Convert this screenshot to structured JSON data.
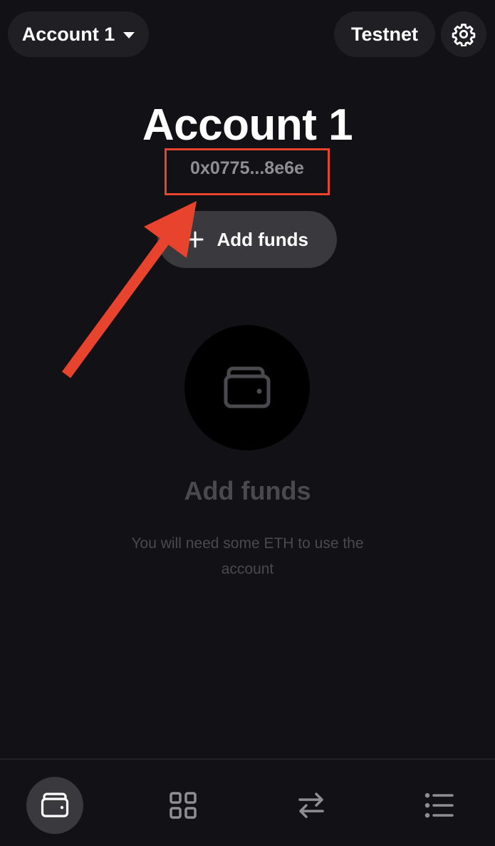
{
  "header": {
    "account_selector_label": "Account 1",
    "network_label": "Testnet"
  },
  "account": {
    "name": "Account 1",
    "address_short": "0x0775...8e6e"
  },
  "actions": {
    "add_funds_label": "Add funds"
  },
  "empty_state": {
    "title": "Add funds",
    "description": "You will need some ETH to use the account"
  },
  "bottom_nav": {
    "items": [
      {
        "icon": "wallet-icon",
        "active": true
      },
      {
        "icon": "apps-grid-icon",
        "active": false
      },
      {
        "icon": "swap-arrows-icon",
        "active": false
      },
      {
        "icon": "list-icon",
        "active": false
      }
    ]
  },
  "colors": {
    "background": "#121216",
    "pill": "#202024",
    "button": "#3a3a3e",
    "highlight": "#e8432c",
    "muted_text": "#4a4a4e",
    "address_text": "#8e8e93"
  }
}
